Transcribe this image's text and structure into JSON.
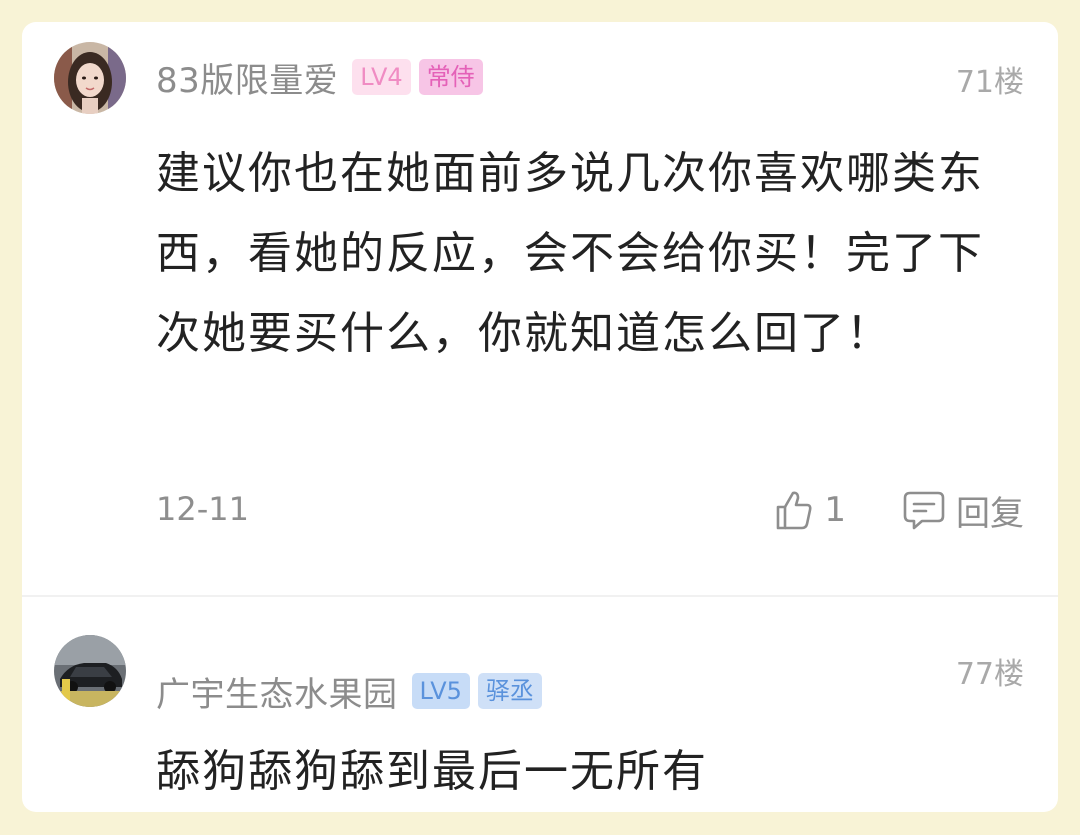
{
  "comments": [
    {
      "username": "83版限量爱",
      "level": "LV4",
      "title": "常侍",
      "floor": "71楼",
      "text": "建议你也在她面前多说几次你喜欢哪类东西，看她的反应，会不会给你买！完了下次她要买什么，你就知道怎么回了！",
      "date": "12-11",
      "likes": "1",
      "reply_label": "回复",
      "avatar_icon": "avatar-woman",
      "colors": {
        "level_badge": "#fde0ee",
        "title_badge": "#f7c5e6"
      }
    },
    {
      "username": "广宇生态水果园",
      "level": "LV5",
      "title": "驿丞",
      "floor": "77楼",
      "text": "舔狗舔狗舔到最后一无所有",
      "avatar_icon": "avatar-car",
      "colors": {
        "level_badge": "#c7dcf7",
        "title_badge": "#cfe0f7"
      }
    }
  ],
  "icons": {
    "like": "thumbs-up-icon",
    "reply": "comment-bubble-icon"
  },
  "colors": {
    "page_background": "#f8f3d6",
    "card_background": "#ffffff",
    "meta_text": "#8e8e8e"
  }
}
